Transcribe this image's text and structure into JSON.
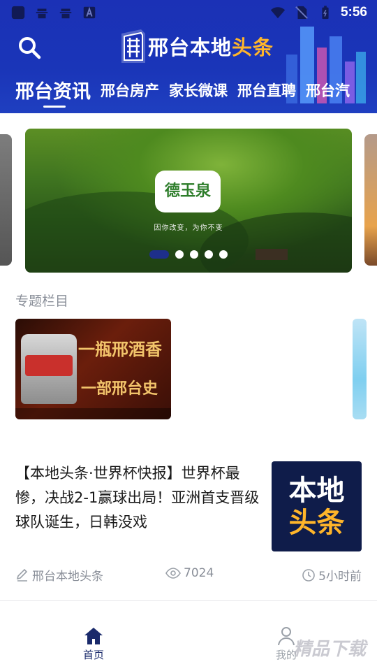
{
  "status_bar": {
    "time": "5:56",
    "left_icons": [
      "app-square-icon",
      "bug-icon",
      "bug-icon",
      "a-box-icon"
    ],
    "right_icons": [
      "wifi-icon",
      "no-sim-icon",
      "battery-icon"
    ]
  },
  "header": {
    "logo_main": "邢台本地",
    "logo_accent": "头条",
    "search_icon": "search-icon",
    "colors": {
      "background": "#1b31b6",
      "accent": "#ffb52a"
    }
  },
  "tabs": [
    {
      "label": "邢台资讯",
      "active": true
    },
    {
      "label": "邢台房产",
      "active": false
    },
    {
      "label": "家长微课",
      "active": false
    },
    {
      "label": "邢台直聘",
      "active": false
    },
    {
      "label": "邢台汽",
      "active": false
    }
  ],
  "banner": {
    "brand_name": "德玉泉",
    "slogan": "因你改变，为你不变",
    "slide_count": 5,
    "active_slide": 0
  },
  "section": {
    "title": "专题栏目",
    "topic_card": {
      "line1": "一瓶邢酒香",
      "line2": "一部邢台史"
    }
  },
  "news": {
    "title": "【本地头条·世界杯快报】世界杯最惨，决战2-1赢球出局！亚洲首支晋级球队诞生，日韩没戏",
    "thumb_line1": "本地",
    "thumb_line2": "头条",
    "author": "邢台本地头条",
    "views": "7024",
    "time": "5小时前"
  },
  "bottom_nav": {
    "home_label": "首页",
    "mine_label": "我的"
  },
  "watermark": "精品下载"
}
